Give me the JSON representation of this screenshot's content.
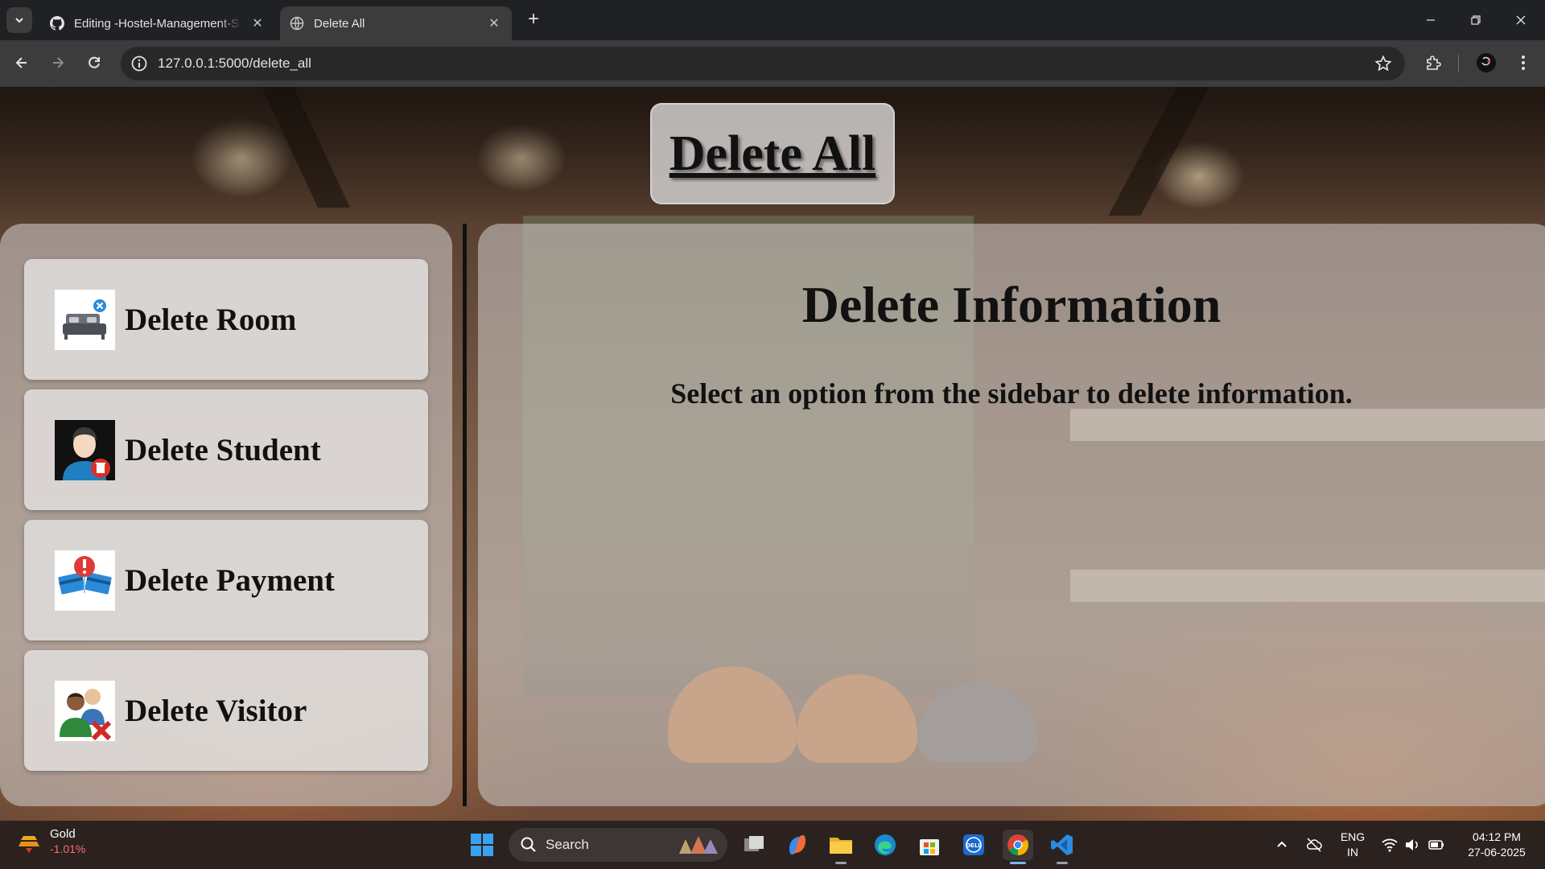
{
  "browser": {
    "tabs": [
      {
        "title": "Editing -Hostel-Management-S",
        "active": false,
        "favicon": "github-icon"
      },
      {
        "title": "Delete All",
        "active": true,
        "favicon": "globe-icon"
      }
    ],
    "url": "127.0.0.1:5000/delete_all"
  },
  "page": {
    "title": "Delete All",
    "sidebar": {
      "items": [
        {
          "label": "Delete Room",
          "icon": "bed-delete-icon"
        },
        {
          "label": "Delete Student",
          "icon": "student-delete-icon"
        },
        {
          "label": "Delete Payment",
          "icon": "payment-alert-icon"
        },
        {
          "label": "Delete Visitor",
          "icon": "visitor-delete-icon"
        }
      ]
    },
    "main": {
      "heading": "Delete Information",
      "subtext": "Select an option from the sidebar to delete information."
    }
  },
  "taskbar": {
    "widget": {
      "name": "Gold",
      "change": "-1.01%"
    },
    "search_label": "Search",
    "language": {
      "line1": "ENG",
      "line2": "IN"
    },
    "time": "04:12 PM",
    "date": "27-06-2025"
  },
  "colors": {
    "chrome_bg": "#202124",
    "toolbar_bg": "#3c3c3c",
    "panel_tint": "#c8c4c2",
    "taskbar_bg": "#2b2220",
    "negative": "#ff6b6b"
  }
}
